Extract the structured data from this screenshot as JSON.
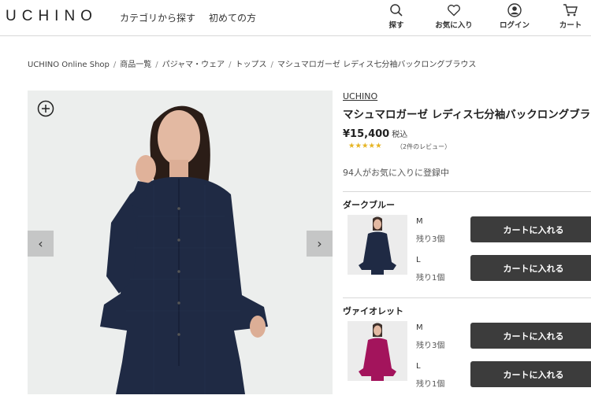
{
  "header": {
    "logo": "UCHINO",
    "nav": [
      "カテゴリから探す",
      "初めての方"
    ],
    "icons": [
      {
        "name": "search-icon",
        "label": "探す"
      },
      {
        "name": "heart-icon",
        "label": "お気に入り"
      },
      {
        "name": "user-icon",
        "label": "ログイン"
      },
      {
        "name": "cart-icon",
        "label": "カート"
      }
    ]
  },
  "breadcrumb": [
    "UCHINO Online Shop",
    "商品一覧",
    "パジャマ・ウェア",
    "トップス",
    "マシュマロガーゼ レディス七分袖バックロングブラウス"
  ],
  "product": {
    "brand": "UCHINO",
    "title": "マシュマロガーゼ レディス七分袖バックロングブラ",
    "price": "¥15,400",
    "tax": "税込",
    "stars": "★★★★★",
    "rating": 5,
    "review": "（2件のレビュー）",
    "favorites": "94人がお気に入りに登録中"
  },
  "variants": [
    {
      "color": "ダークブルー",
      "shirt_color": "#1f2a44",
      "sizes": [
        {
          "size": "M",
          "stock": "残り3個",
          "button": "カートに入れる"
        },
        {
          "size": "L",
          "stock": "残り1個",
          "button": "カートに入れる"
        }
      ]
    },
    {
      "color": "ヴァイオレット",
      "shirt_color": "#a3145c",
      "sizes": [
        {
          "size": "M",
          "stock": "残り3個",
          "button": "カートに入れる"
        },
        {
          "size": "L",
          "stock": "残り1個",
          "button": "カートに入れる"
        }
      ]
    }
  ],
  "colors": {
    "button_bg": "#3c3c3c",
    "star": "#e6b422",
    "main_shirt": "#1f2a44"
  }
}
